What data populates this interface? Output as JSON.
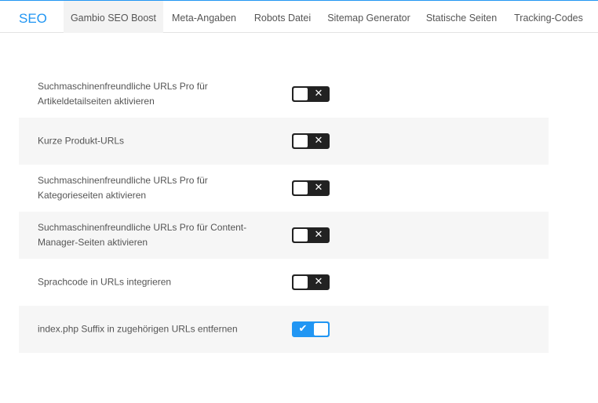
{
  "header": {
    "brand": "SEO",
    "tabs": [
      {
        "label": "Gambio SEO Boost",
        "active": true
      },
      {
        "label": "Meta-Angaben",
        "active": false
      },
      {
        "label": "Robots Datei",
        "active": false
      },
      {
        "label": "Sitemap Generator",
        "active": false
      },
      {
        "label": "Statische Seiten",
        "active": false
      },
      {
        "label": "Tracking-Codes",
        "active": false
      }
    ]
  },
  "settings": [
    {
      "label": "Suchmaschinenfreundliche URLs Pro für Artikeldetailseiten aktivieren",
      "enabled": false,
      "icon": "x-icon"
    },
    {
      "label": "Kurze Produkt-URLs",
      "enabled": false,
      "icon": "x-icon"
    },
    {
      "label": "Suchmaschinenfreundliche URLs Pro für Kategorieseiten aktivieren",
      "enabled": false,
      "icon": "x-icon"
    },
    {
      "label": "Suchmaschinenfreundliche URLs Pro für Content-Manager-Seiten aktivieren",
      "enabled": false,
      "icon": "x-icon"
    },
    {
      "label": "Sprachcode in URLs integrieren",
      "enabled": false,
      "icon": "x-icon"
    },
    {
      "label": "index.php Suffix in zugehörigen URLs entfernen",
      "enabled": true,
      "icon": "checkmark-icon"
    }
  ],
  "colors": {
    "accent": "#2196f3",
    "toggle_off": "#222222",
    "row_shade": "#f6f6f6"
  }
}
